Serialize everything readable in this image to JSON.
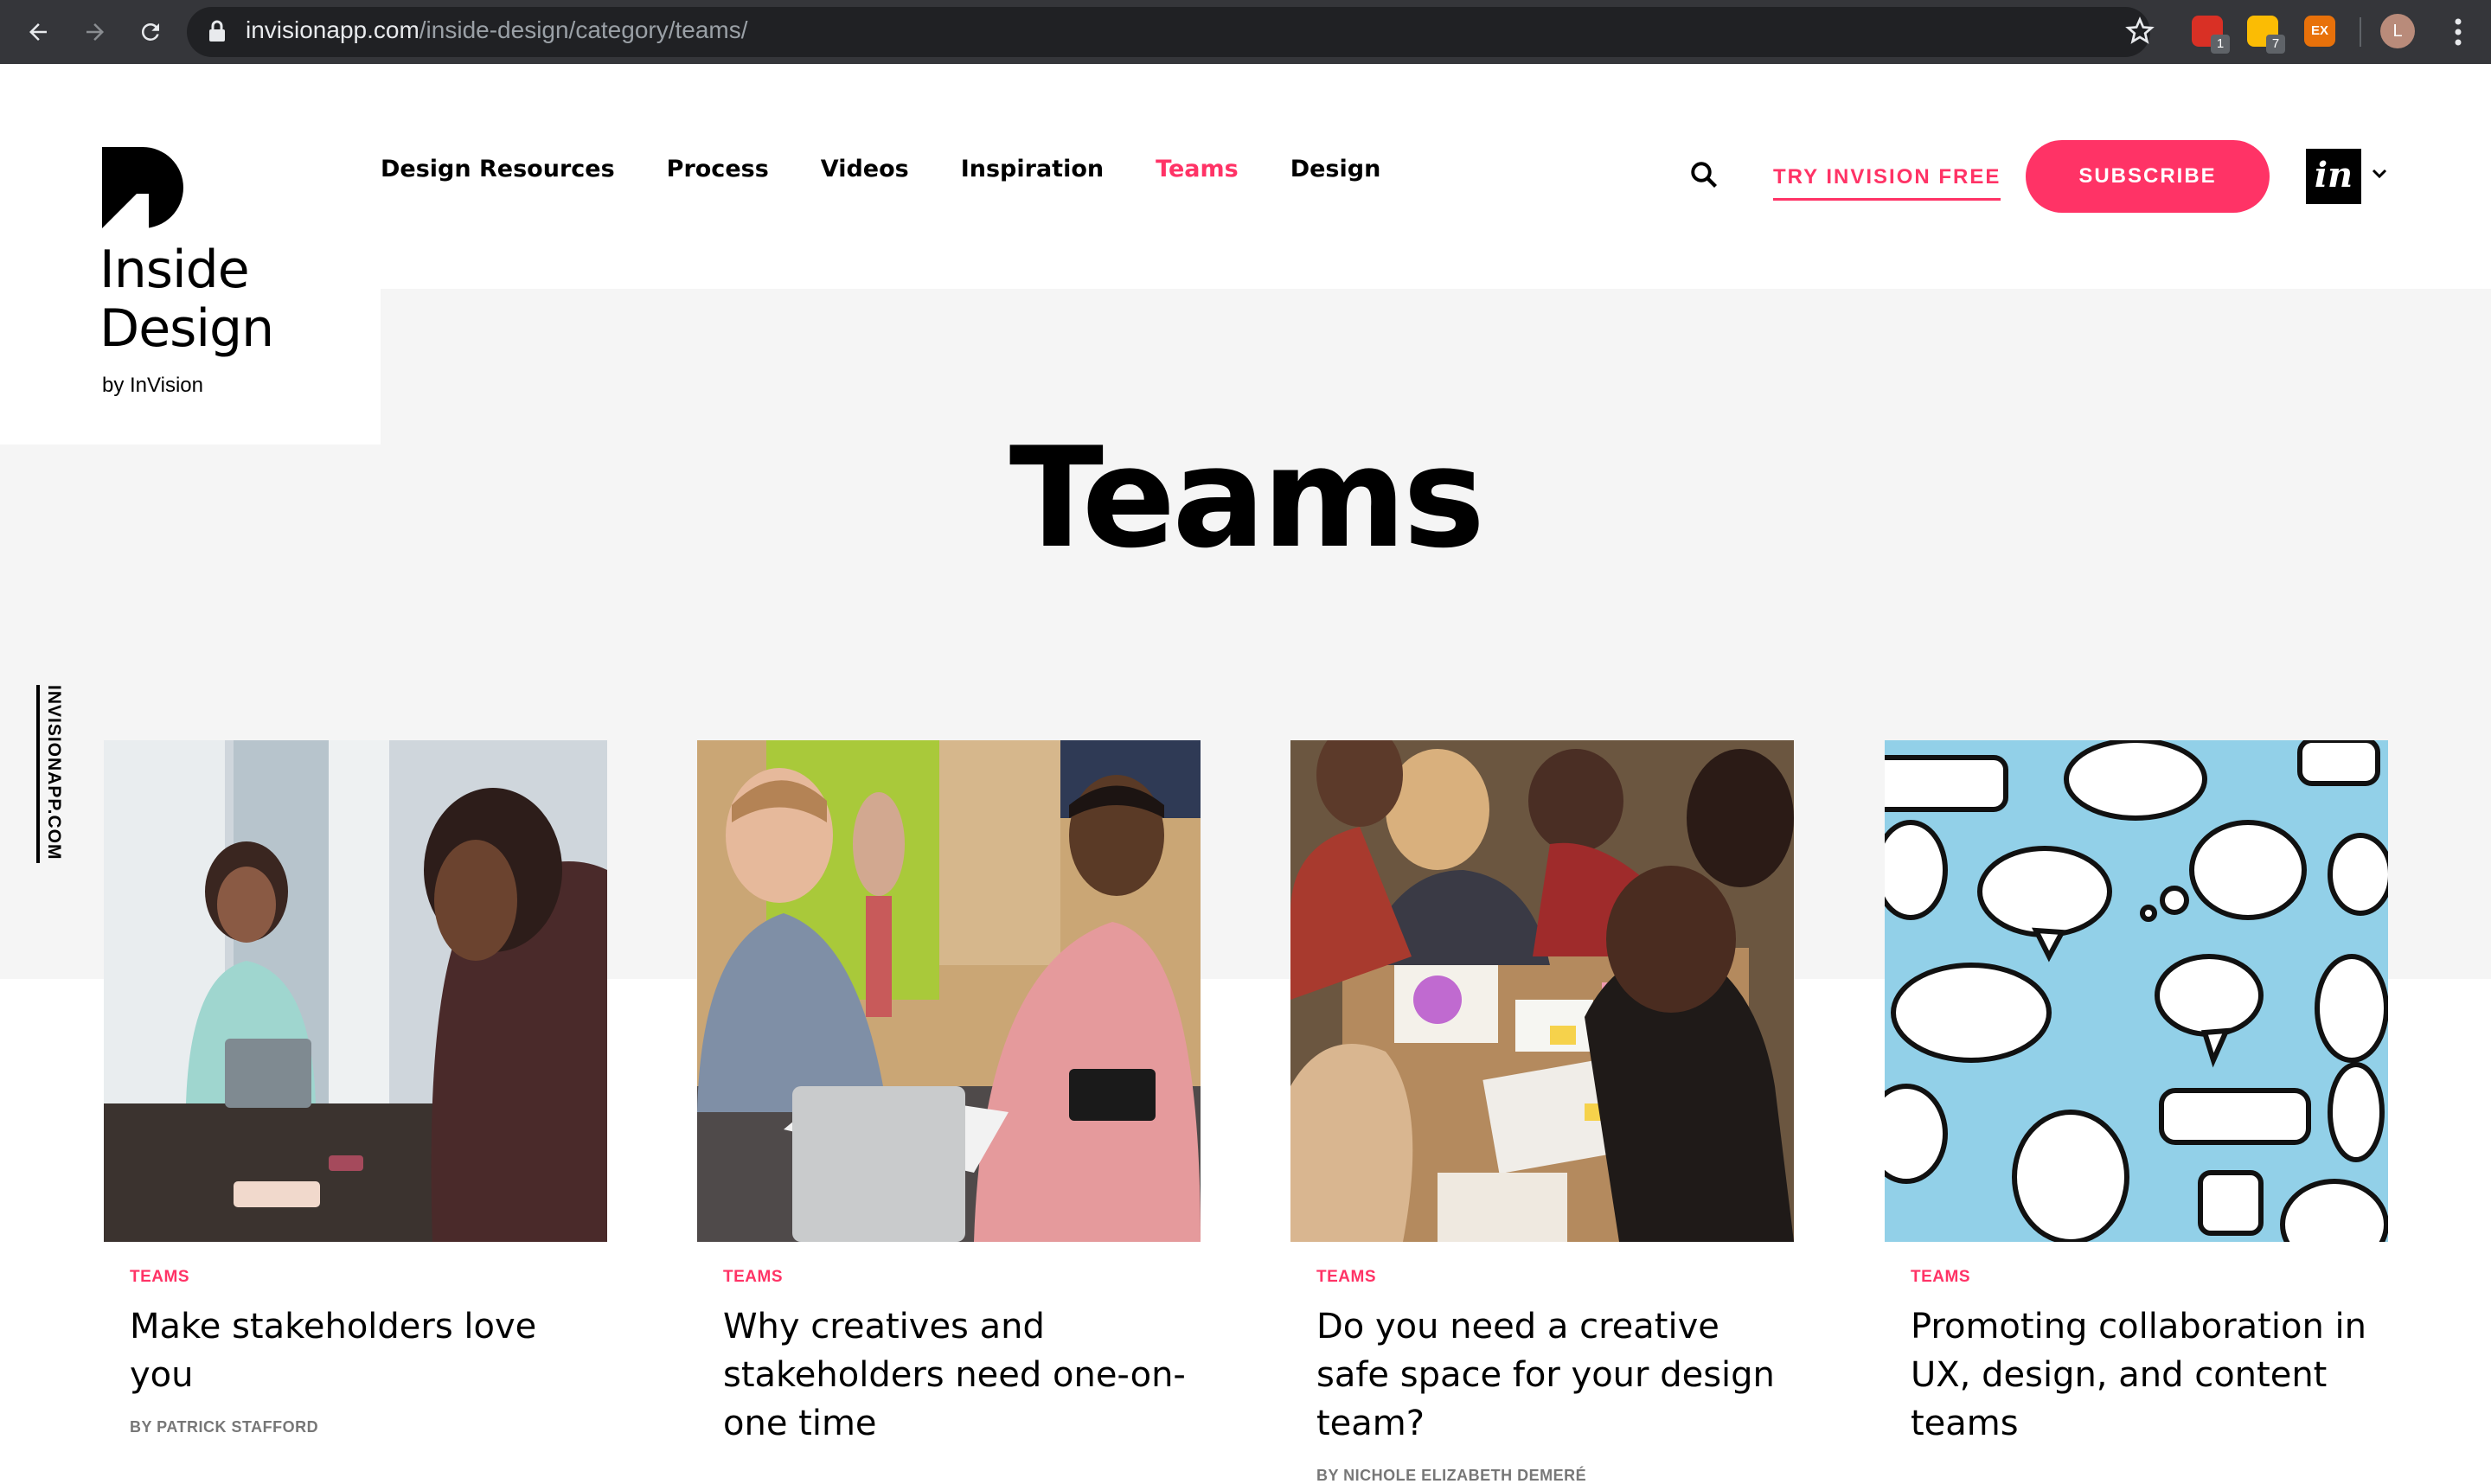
{
  "browser": {
    "url_host": "invisionapp.com",
    "url_path": "/inside-design/category/teams/",
    "profile_initial": "L",
    "extensions": [
      {
        "name": "shield-extension",
        "badge": "1",
        "color": "#d93025"
      },
      {
        "name": "notes-extension",
        "badge": "7",
        "color": "#fbbc04"
      },
      {
        "name": "ex-extension",
        "label": "EX",
        "color": "#e8710a"
      }
    ]
  },
  "brand": {
    "title": "Inside Design",
    "byline": "by InVision"
  },
  "nav": {
    "items": [
      "Design Resources",
      "Process",
      "Videos",
      "Inspiration",
      "Teams",
      "Design"
    ],
    "active": "Teams",
    "try_free": "TRY INVISION FREE",
    "subscribe": "SUBSCRIBE",
    "in_logo": "in"
  },
  "page": {
    "title": "Teams",
    "side_label": "INVISIONAPP.COM"
  },
  "colors": {
    "accent": "#ff3366",
    "band": "#f5f5f5"
  },
  "articles": [
    {
      "category": "TEAMS",
      "title": "Make stakeholders love you",
      "author": "BY PATRICK STAFFORD",
      "image": "meeting-photo"
    },
    {
      "category": "TEAMS",
      "title": "Why creatives and stakeholders need one-on-one time",
      "author": "",
      "image": "laptop-photo"
    },
    {
      "category": "TEAMS",
      "title": "Do you need a creative safe space for your design team?",
      "author": "BY NICHOLE ELIZABETH DEMERÉ",
      "image": "workshop-photo"
    },
    {
      "category": "TEAMS",
      "title": "Promoting collaboration in UX, design, and content teams",
      "author": "",
      "image": "speech-bubbles-illustration"
    }
  ]
}
